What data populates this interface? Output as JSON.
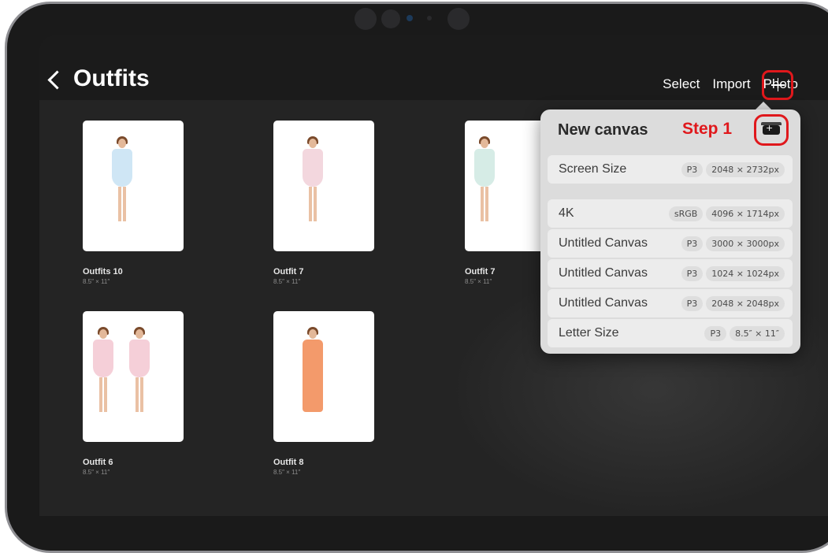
{
  "header": {
    "back_title": "Outfits",
    "actions": {
      "select": "Select",
      "import": "Import",
      "photo": "Photo"
    }
  },
  "gallery": [
    {
      "name": "Outfits 10",
      "size": "8.5″ × 11″",
      "dress_color": "#cfe6f5"
    },
    {
      "name": "Outfit 7",
      "size": "8.5″ × 11″",
      "dress_color": "#f3d7de"
    },
    {
      "name": "Outfit 7",
      "size": "8.5″ × 11″",
      "dress_color": "#d6ece6"
    },
    {
      "name": "Outfit 6",
      "size": "8.5″ × 11″",
      "dress_color": "#f5cfd8"
    },
    {
      "name": "Outfit 8",
      "size": "8.5″ × 11″",
      "dress_color": "#f39a6b"
    }
  ],
  "popover": {
    "title": "New canvas",
    "annotation": "Step 1",
    "presets": [
      {
        "label": "Screen Size",
        "color": "P3",
        "dims": "2048 × 2732px"
      },
      {
        "label": "4K",
        "color": "sRGB",
        "dims": "4096 × 1714px"
      },
      {
        "label": "Untitled Canvas",
        "color": "P3",
        "dims": "3000 × 3000px"
      },
      {
        "label": "Untitled Canvas",
        "color": "P3",
        "dims": "1024 × 1024px"
      },
      {
        "label": "Untitled Canvas",
        "color": "P3",
        "dims": "2048 × 2048px"
      },
      {
        "label": "Letter Size",
        "color": "P3",
        "dims": "8.5″ × 11″"
      }
    ]
  },
  "colors": {
    "annotation_red": "#e0181c",
    "screen_bg": "#242424"
  }
}
